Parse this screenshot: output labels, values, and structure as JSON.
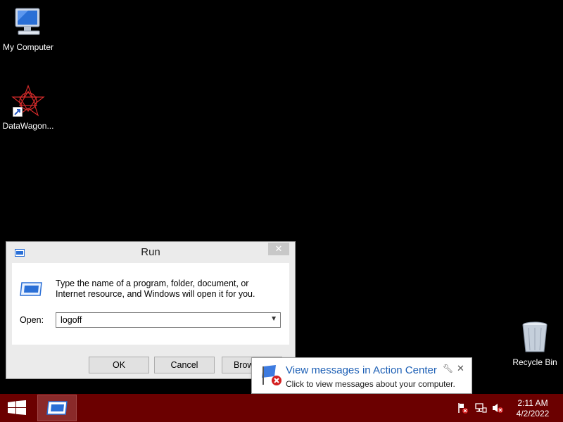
{
  "desktop": {
    "icons": [
      {
        "label": "My Computer"
      },
      {
        "label": "DataWagon..."
      },
      {
        "label": "Recycle Bin"
      }
    ]
  },
  "run_dialog": {
    "title": "Run",
    "description": "Type the name of a program, folder, document, or Internet resource, and Windows will open it for you.",
    "open_label": "Open:",
    "open_value": "logoff",
    "ok_label": "OK",
    "cancel_label": "Cancel",
    "browse_label": "Browse..."
  },
  "balloon": {
    "title": "View messages in Action Center",
    "message": "Click to view messages about your computer."
  },
  "taskbar": {
    "time": "2:11 AM",
    "date": "4/2/2022",
    "color": "#6b0000"
  },
  "icons": [
    "computer-icon",
    "shortcut-arrow-icon",
    "recycle-bin-icon",
    "run-icon",
    "close-icon",
    "windows-logo-icon",
    "action-center-flag-icon",
    "network-icon",
    "volume-muted-icon",
    "wrench-icon"
  ]
}
